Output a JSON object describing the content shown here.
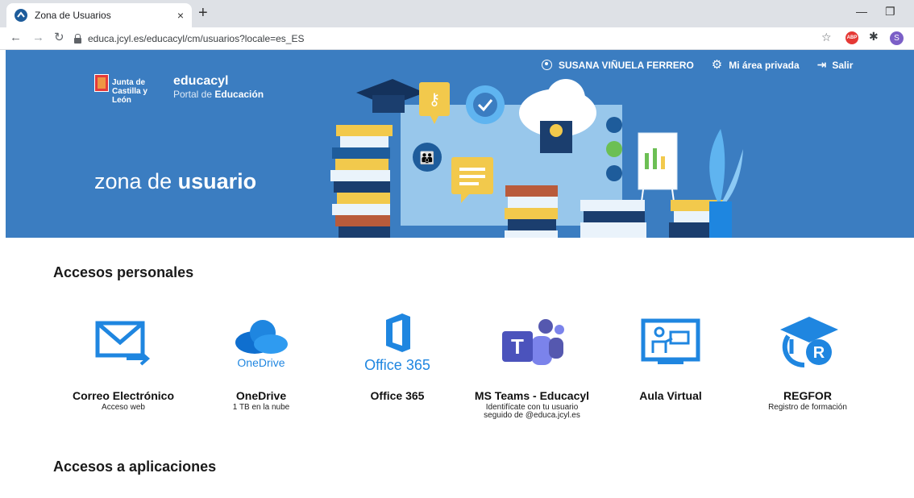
{
  "browser": {
    "tab_title": "Zona de Usuarios",
    "tab_close": "×",
    "new_tab": "+",
    "url": "educa.jcyl.es/educacyl/cm/usuarios?locale=es_ES",
    "profile_letter": "S",
    "abp_label": "ABP"
  },
  "header": {
    "user_name": "SUSANA VIÑUELA FERRERO",
    "private_area": "Mi área privada",
    "logout": "Salir"
  },
  "brand": {
    "junta": "Junta de Castilla y León",
    "portal_name": "educacyl",
    "portal_prefix": "Portal de",
    "portal_bold": "Educación",
    "zone_prefix": "zona de",
    "zone_bold": "usuario"
  },
  "sections": {
    "personal": "Accesos personales",
    "apps": "Accesos a aplicaciones"
  },
  "tiles": [
    {
      "name": "Correo Electrónico",
      "desc": "Acceso web",
      "icon": "mail-icon"
    },
    {
      "name": "OneDrive",
      "desc": "1 TB en la nube",
      "icon": "onedrive-icon",
      "logo_text": "OneDrive"
    },
    {
      "name": "Office 365",
      "desc": "",
      "icon": "office365-icon",
      "logo_text": "Office 365"
    },
    {
      "name": "MS Teams - Educacyl",
      "desc": "Identifícate con tu usuario seguido de @educa.jcyl.es",
      "icon": "teams-icon",
      "logo_letter": "T"
    },
    {
      "name": "Aula Virtual",
      "desc": "",
      "icon": "classroom-icon"
    },
    {
      "name": "REGFOR",
      "desc": "Registro de formación",
      "icon": "regfor-icon",
      "logo_letter": "R"
    }
  ],
  "colors": {
    "hero": "#3b7dc1",
    "icon_blue": "#1f86e0",
    "teams": "#5558af"
  }
}
